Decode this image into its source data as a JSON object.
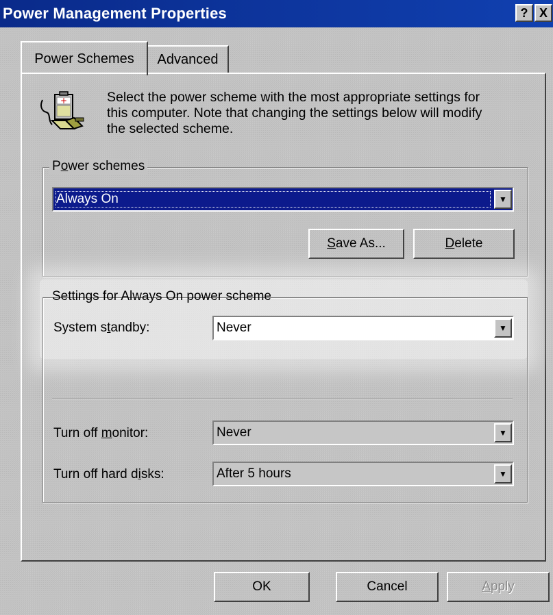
{
  "window": {
    "title": "Power Management Properties",
    "help_button": "?",
    "close_button": "X",
    "title_bar_color": "#0a2a8a"
  },
  "tabs": [
    {
      "label": "Power Schemes",
      "active": true
    },
    {
      "label": "Advanced",
      "active": false
    }
  ],
  "intro": {
    "icon": "power-plug-battery-icon",
    "line1": "Select the power scheme with the most appropriate settings for",
    "line2": "this computer. Note that changing the settings below will modify",
    "line3": "the selected scheme."
  },
  "power_schemes": {
    "label_prefix": "P",
    "label_accel": "o",
    "label_suffix": "wer schemes",
    "selected": "Always On",
    "save_as_accel": "S",
    "save_as_rest": "ave As...",
    "delete_accel": "D",
    "delete_rest": "elete"
  },
  "settings": {
    "group_label": "Settings for Always On power scheme",
    "standby_prefix": "System s",
    "standby_accel": "t",
    "standby_suffix": "andby:",
    "standby_value": "Never",
    "monitor_prefix": "Turn off ",
    "monitor_accel": "m",
    "monitor_suffix": "onitor:",
    "monitor_value": "Never",
    "disks_prefix": "Turn off hard d",
    "disks_accel": "i",
    "disks_suffix": "sks:",
    "disks_value": "After 5 hours"
  },
  "footer": {
    "ok": "OK",
    "cancel": "Cancel",
    "apply_accel": "A",
    "apply_rest": "pply"
  },
  "colors": {
    "selection": "#0c1a8c",
    "dialog_bg": "#c3c3c3"
  }
}
